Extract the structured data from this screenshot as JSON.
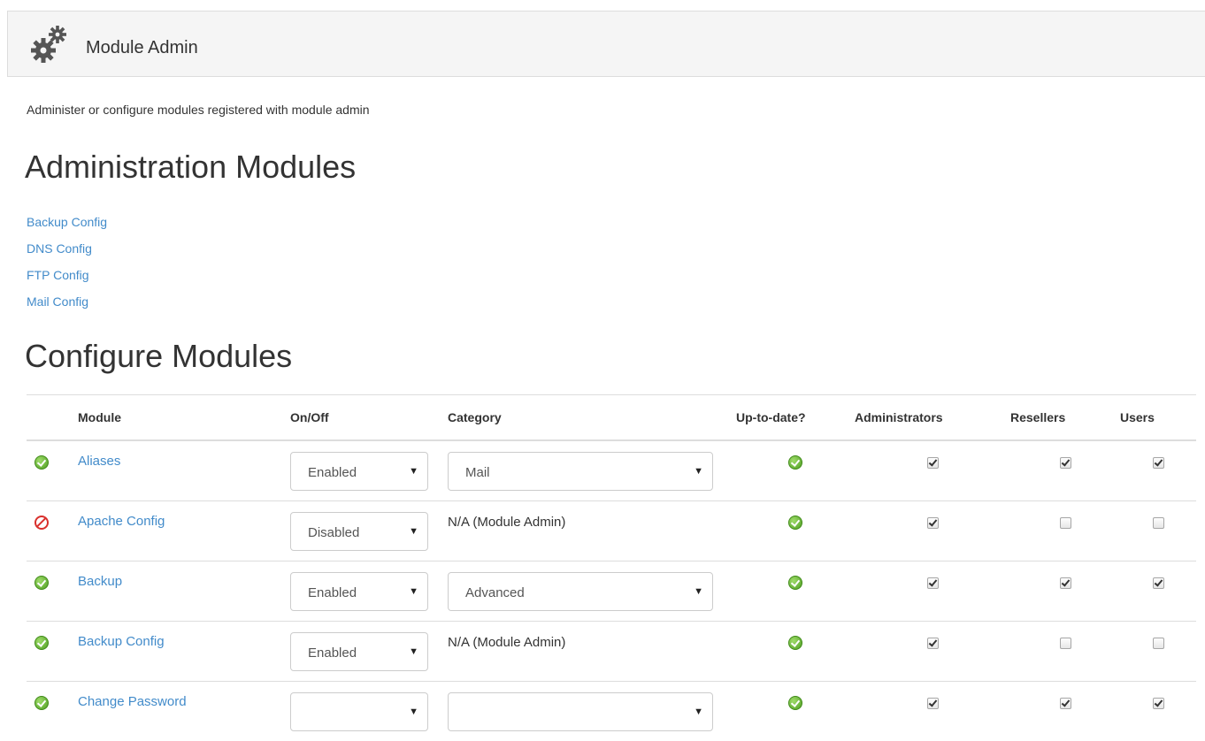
{
  "header": {
    "title": "Module Admin",
    "icon": "gears-icon"
  },
  "description": "Administer or configure modules registered with module admin",
  "admin_section": {
    "heading": "Administration Modules",
    "links": [
      "Backup Config",
      "DNS Config",
      "FTP Config",
      "Mail Config"
    ]
  },
  "config_section": {
    "heading": "Configure Modules",
    "columns": {
      "module": "Module",
      "onoff": "On/Off",
      "category": "Category",
      "uptodate": "Up-to-date?",
      "administrators": "Administrators",
      "resellers": "Resellers",
      "users": "Users"
    },
    "rows": [
      {
        "status": "enabled",
        "module": "Aliases",
        "onoff": "Enabled",
        "category_type": "select",
        "category": "Mail",
        "uptodate": true,
        "administrators": true,
        "resellers": true,
        "users": true
      },
      {
        "status": "disabled",
        "module": "Apache Config",
        "onoff": "Disabled",
        "category_type": "text",
        "category": "N/A (Module Admin)",
        "uptodate": true,
        "administrators": true,
        "resellers": false,
        "users": false
      },
      {
        "status": "enabled",
        "module": "Backup",
        "onoff": "Enabled",
        "category_type": "select",
        "category": "Advanced",
        "uptodate": true,
        "administrators": true,
        "resellers": true,
        "users": true
      },
      {
        "status": "enabled",
        "module": "Backup Config",
        "onoff": "Enabled",
        "category_type": "text",
        "category": "N/A (Module Admin)",
        "uptodate": true,
        "administrators": true,
        "resellers": false,
        "users": false
      },
      {
        "status": "enabled",
        "module": "Change Password",
        "onoff": "",
        "category_type": "select",
        "category": "",
        "uptodate": true,
        "administrators": true,
        "resellers": true,
        "users": true
      }
    ]
  },
  "colors": {
    "link": "#428bca",
    "ok": "#4f9e22",
    "disabled": "#d9302c",
    "header_bg": "#f5f5f5"
  }
}
